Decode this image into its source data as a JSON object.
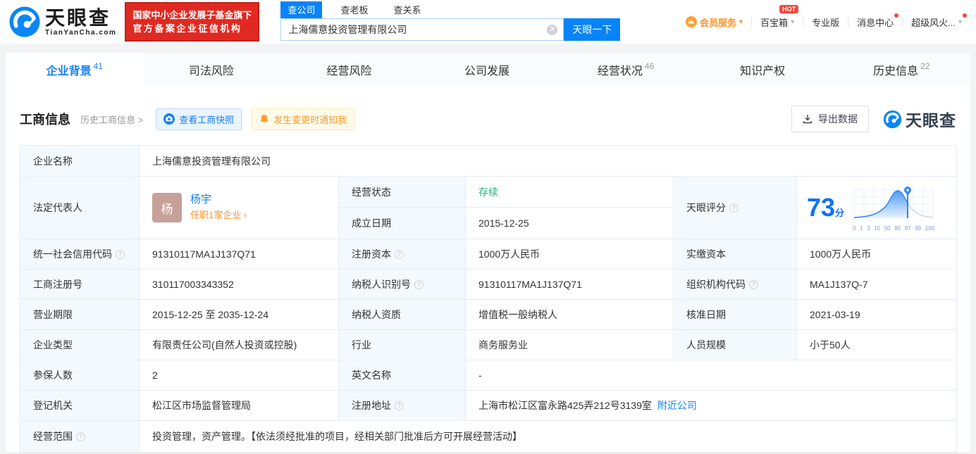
{
  "colors": {
    "brand_blue": "#0884f8",
    "accent_orange": "#ff8e2a",
    "status_green": "#23b571",
    "alert_red": "#f5473b",
    "badge_red": "#e02a21"
  },
  "header": {
    "logo": {
      "title": "天眼查",
      "domain": "TianYanCha.com"
    },
    "badge": {
      "line1": "国家中小企业发展子基金旗下",
      "line2": "官方备案企业征信机构"
    },
    "search": {
      "tabs": [
        {
          "label": "查公司"
        },
        {
          "label": "查老板"
        },
        {
          "label": "查关系"
        }
      ],
      "value": "上海儒意投资管理有限公司",
      "button": "天眼一下"
    },
    "nav": {
      "vip": "会员服务",
      "toolbox": "百宝箱",
      "hot": "HOT",
      "pro": "专业版",
      "messages": "消息中心",
      "super": "超级风火..."
    }
  },
  "tabs": [
    {
      "label": "企业背景",
      "count": "41"
    },
    {
      "label": "司法风险",
      "count": ""
    },
    {
      "label": "经营风险",
      "count": ""
    },
    {
      "label": "公司发展",
      "count": ""
    },
    {
      "label": "经营状况",
      "count": "46"
    },
    {
      "label": "知识产权",
      "count": ""
    },
    {
      "label": "历史信息",
      "count": "22"
    }
  ],
  "toolbar": {
    "title": "工商信息",
    "history_link": "历史工商信息 >",
    "snapshot_button": "查看工商快照",
    "notify_button": "发生变更时通知我",
    "export_button": "导出数据",
    "watermark": "天眼查"
  },
  "info": {
    "company_name": {
      "label": "企业名称",
      "value": "上海儒意投资管理有限公司"
    },
    "legal_rep": {
      "label": "法定代表人",
      "avatar": "杨",
      "name": "杨宇",
      "link": "任职1家企业 ›"
    },
    "status": {
      "label": "经营状态",
      "value": "存续"
    },
    "established": {
      "label": "成立日期",
      "value": "2015-12-25"
    },
    "score": {
      "label": "天眼评分",
      "value": "73",
      "unit": "分",
      "axis": [
        "0",
        "1",
        "3",
        "15",
        "50",
        "85",
        "97",
        "99",
        "100"
      ]
    },
    "uscc": {
      "label": "统一社会信用代码",
      "value": "91310117MA1J137Q71"
    },
    "reg_capital": {
      "label": "注册资本",
      "value": "1000万人民币"
    },
    "paid_capital": {
      "label": "实缴资本",
      "value": "1000万人民币"
    },
    "reg_no": {
      "label": "工商注册号",
      "value": "310117003343352"
    },
    "taxpayer_id": {
      "label": "纳税人识别号",
      "value": "91310117MA1J137Q71"
    },
    "org_code": {
      "label": "组织机构代码",
      "value": "MA1J137Q-7"
    },
    "term": {
      "label": "营业期限",
      "value": "2015-12-25 至 2035-12-24"
    },
    "taxpayer_quali": {
      "label": "纳税人资质",
      "value": "增值税一般纳税人"
    },
    "approval_date": {
      "label": "核准日期",
      "value": "2021-03-19"
    },
    "company_type": {
      "label": "企业类型",
      "value": "有限责任公司(自然人投资或控股)"
    },
    "industry": {
      "label": "行业",
      "value": "商务服务业"
    },
    "staff_size": {
      "label": "人员规模",
      "value": "小于50人"
    },
    "insured_count": {
      "label": "参保人数",
      "value": "2"
    },
    "english_name": {
      "label": "英文名称",
      "value": "-"
    },
    "registry": {
      "label": "登记机关",
      "value": "松江区市场监督管理局"
    },
    "address": {
      "label": "注册地址",
      "value": "上海市松江区富永路425弄212号3139室",
      "link": "附近公司"
    },
    "business_scope": {
      "label": "经营范围",
      "value": "投资管理，资产管理。【依法须经批准的项目，经相关部门批准后方可开展经营活动】"
    }
  }
}
